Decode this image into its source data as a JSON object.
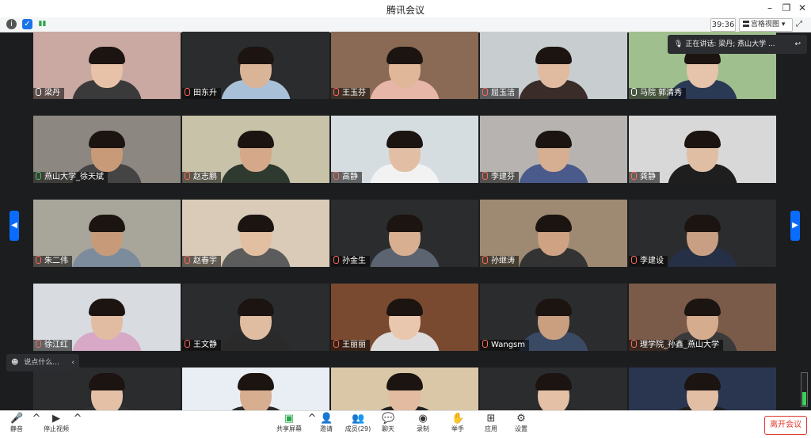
{
  "window": {
    "title": "腾讯会议"
  },
  "infobar": {
    "timer": "39:36",
    "view_label": "宫格视图"
  },
  "speaking": {
    "text": "正在讲话: 梁丹; 燕山大学 ..."
  },
  "chat": {
    "placeholder": "说点什么..."
  },
  "participants": [
    {
      "name": "梁丹",
      "bg": "#c9a9a2",
      "skin": "#e8c2a8",
      "shirt": "#3a3a3a",
      "mic": "on"
    },
    {
      "name": "田东升",
      "bg": "#2b2c2e",
      "skin": "#d9b496",
      "shirt": "#a8c0d8",
      "mic": "muted"
    },
    {
      "name": "王玉芬",
      "bg": "#8a6a55",
      "skin": "#e1b79a",
      "shirt": "#e7b6a9",
      "mic": "muted"
    },
    {
      "name": "屈玉洁",
      "bg": "#c8cdd0",
      "skin": "#e0bba0",
      "shirt": "#3a2c28",
      "mic": "muted"
    },
    {
      "name": "马院 郭清秀",
      "bg": "#9fbf8e",
      "skin": "#e6c3ab",
      "shirt": "#2a3a55",
      "mic": "on"
    },
    {
      "name": "燕山大学_徐天斌",
      "bg": "#8c8780",
      "skin": "#c99a78",
      "shirt": "#444",
      "mic": "green"
    },
    {
      "name": "赵志鹏",
      "bg": "#c7c2a8",
      "skin": "#d4a888",
      "shirt": "#2e3a30",
      "mic": "muted"
    },
    {
      "name": "高静",
      "bg": "#d6dde0",
      "skin": "#e2bfa4",
      "shirt": "#f2f2f2",
      "mic": "muted"
    },
    {
      "name": "李建芬",
      "bg": "#b7b3b0",
      "skin": "#d6ae92",
      "shirt": "#4a5a8a",
      "mic": "muted"
    },
    {
      "name": "龚静",
      "bg": "#d8d8d8",
      "skin": "#e0bea4",
      "shirt": "#1e1e1e",
      "mic": "muted"
    },
    {
      "name": "朱二伟",
      "bg": "#a8a59a",
      "skin": "#c79b7a",
      "shirt": "#7d8c9c",
      "mic": "muted"
    },
    {
      "name": "赵春宇",
      "bg": "#d9cbb7",
      "skin": "#e3bfa2",
      "shirt": "#5c5c5c",
      "mic": "muted"
    },
    {
      "name": "孙金生",
      "bg": "#2b2c2e",
      "skin": "#d8b091",
      "shirt": "#5b6470",
      "mic": "muted"
    },
    {
      "name": "孙继涛",
      "bg": "#9e8a72",
      "skin": "#cfa283",
      "shirt": "#333",
      "mic": "muted"
    },
    {
      "name": "李建设",
      "bg": "#2b2c2e",
      "skin": "#c99f83",
      "shirt": "#253046",
      "mic": "muted"
    },
    {
      "name": "徐江红",
      "bg": "#d8dbe0",
      "skin": "#e2bca2",
      "shirt": "#d7a9c6",
      "mic": "muted"
    },
    {
      "name": "王文静",
      "bg": "#2b2c2e",
      "skin": "#e0bca0",
      "shirt": "#2a2a2a",
      "mic": "muted"
    },
    {
      "name": "王丽丽",
      "bg": "#7a4a30",
      "skin": "#e9c7ae",
      "shirt": "#ddd",
      "mic": "muted"
    },
    {
      "name": "Wangsm",
      "bg": "#2b2c2e",
      "skin": "#c99f80",
      "shirt": "#3b4a64",
      "mic": "muted"
    },
    {
      "name": "理学院_孙鑫_燕山大学",
      "bg": "#7a5a48",
      "skin": "#d6ac8e",
      "shirt": "#3a3a3a",
      "mic": "muted"
    },
    {
      "name": "",
      "bg": "#2b2c2e",
      "skin": "#e4c0a6",
      "shirt": "#333",
      "mic": "none"
    },
    {
      "name": "",
      "bg": "#e9eef5",
      "skin": "#d8ae90",
      "shirt": "#2a2a2a",
      "mic": "none"
    },
    {
      "name": "",
      "bg": "#d9c7a8",
      "skin": "#e2bba0",
      "shirt": "#222",
      "mic": "none"
    },
    {
      "name": "",
      "bg": "#2b2c2e",
      "skin": "#e3c0a6",
      "shirt": "#2a2a2a",
      "mic": "none"
    },
    {
      "name": "",
      "bg": "#2a3550",
      "skin": "#e2bea5",
      "shirt": "#222",
      "mic": "none"
    }
  ],
  "toolbar": {
    "mute": "静音",
    "stop_video": "停止视频",
    "share": "共享屏幕",
    "invite": "邀请",
    "members": "成员(29)",
    "chat": "聊天",
    "record": "录制",
    "raise_hand": "举手",
    "apps": "应用",
    "settings": "设置",
    "leave": "离开会议"
  },
  "colors": {
    "accent": "#0a6cff",
    "danger": "#e03a2f"
  }
}
